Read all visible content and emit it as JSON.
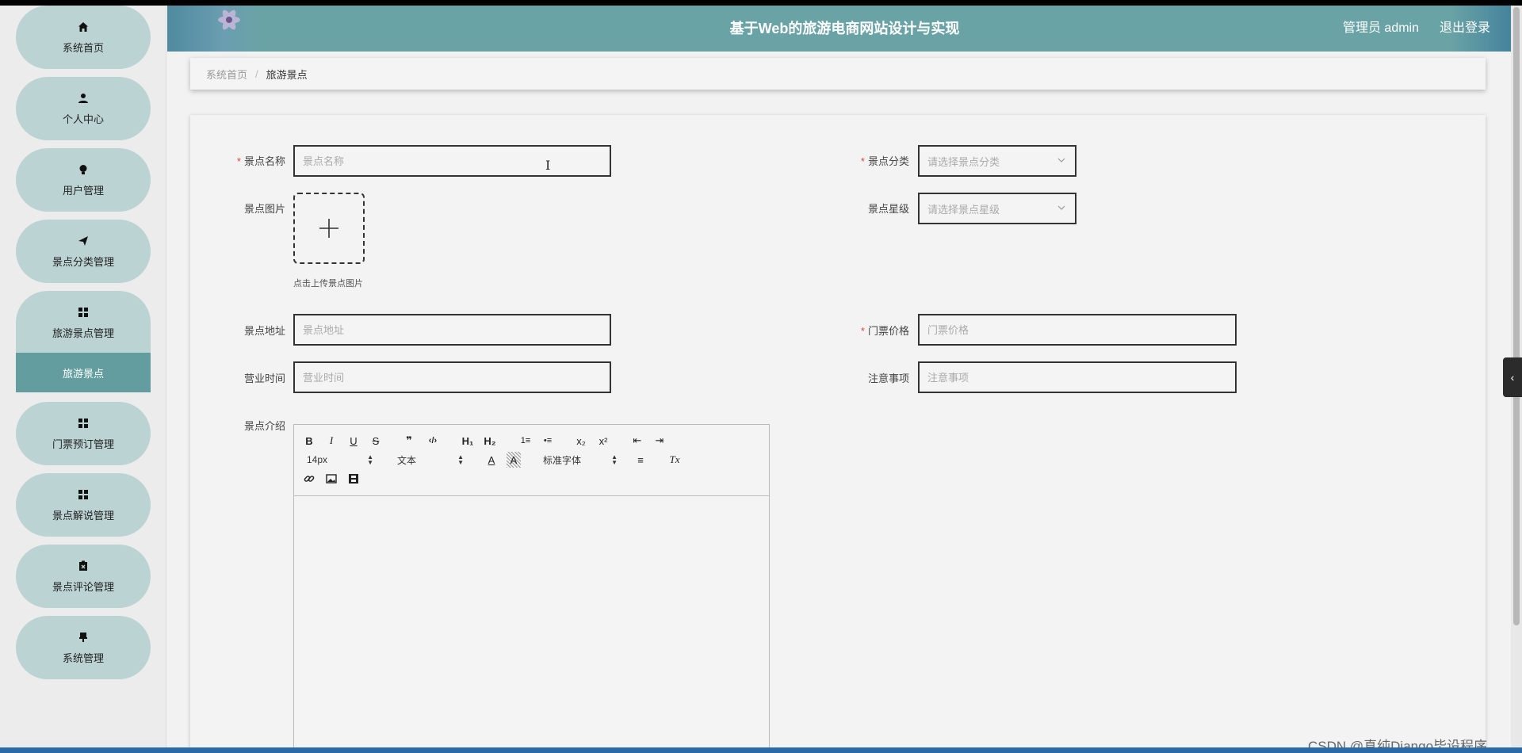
{
  "header": {
    "title": "基于Web的旅游电商网站设计与实现",
    "user_label": "管理员 admin",
    "logout_label": "退出登录"
  },
  "sidebar": {
    "items": [
      {
        "label": "系统首页",
        "icon": "home-icon"
      },
      {
        "label": "个人中心",
        "icon": "user-icon"
      },
      {
        "label": "用户管理",
        "icon": "bulb-icon"
      },
      {
        "label": "景点分类管理",
        "icon": "send-icon"
      },
      {
        "label": "旅游景点管理",
        "icon": "grid-icon"
      },
      {
        "label": "门票预订管理",
        "icon": "grid-icon"
      },
      {
        "label": "景点解说管理",
        "icon": "grid-icon"
      },
      {
        "label": "景点评论管理",
        "icon": "clipboard-icon"
      },
      {
        "label": "系统管理",
        "icon": "pin-icon"
      }
    ],
    "active_sub": "旅游景点"
  },
  "breadcrumb": {
    "home": "系统首页",
    "separator": "/",
    "current": "旅游景点"
  },
  "form": {
    "name": {
      "label": "景点名称",
      "placeholder": "景点名称",
      "required": true
    },
    "category": {
      "label": "景点分类",
      "placeholder": "请选择景点分类",
      "required": true
    },
    "image": {
      "label": "景点图片",
      "tip": "点击上传景点图片"
    },
    "stars": {
      "label": "景点星级",
      "placeholder": "请选择景点星级"
    },
    "address": {
      "label": "景点地址",
      "placeholder": "景点地址"
    },
    "price": {
      "label": "门票价格",
      "placeholder": "门票价格",
      "required": true
    },
    "hours": {
      "label": "营业时间",
      "placeholder": "营业时间"
    },
    "notes": {
      "label": "注意事项",
      "placeholder": "注意事项"
    },
    "intro": {
      "label": "景点介绍"
    },
    "required_mark": "*"
  },
  "editor": {
    "size_select": "14px",
    "format_select": "文本",
    "font_select": "标准字体",
    "buttons": {
      "bold": "B",
      "italic": "I",
      "underline": "U",
      "strike": "S",
      "quote": "❞",
      "code": "‹/›",
      "h1": "H₁",
      "h2": "H₂",
      "ordered_list": "1≡",
      "bullet_list": "•≡",
      "subscript": "x₂",
      "superscript": "x²",
      "outdent": "⇤",
      "indent": "⇥",
      "color": "A",
      "background": "A",
      "align": "≡",
      "clean": "Tx"
    }
  },
  "watermark": "CSDN @真纯Django毕设程序"
}
